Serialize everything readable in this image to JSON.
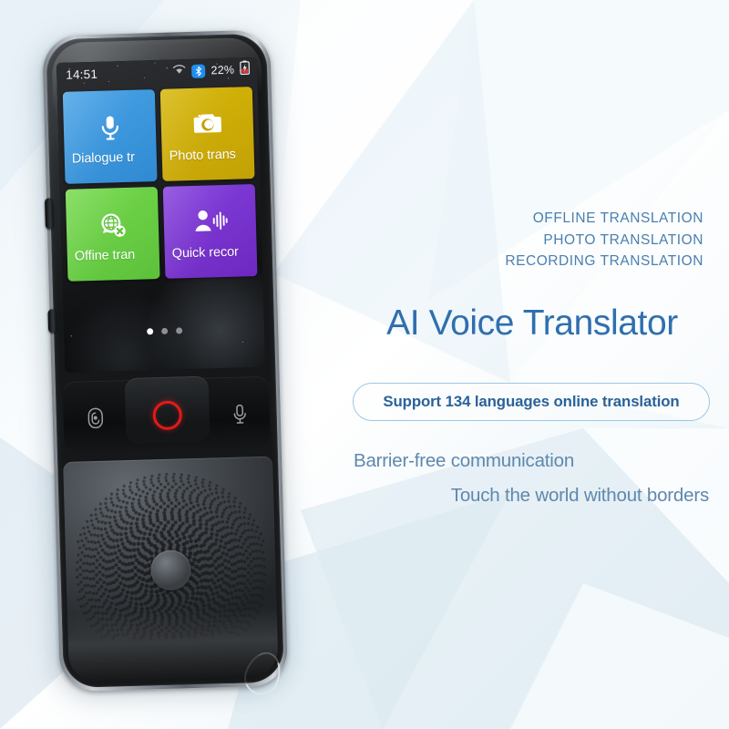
{
  "device": {
    "status_bar": {
      "time": "14:51",
      "wifi_icon": "wifi-icon",
      "bluetooth_icon": "bluetooth-icon",
      "battery_percent": "22%",
      "battery_icon": "battery-charging-icon"
    },
    "tiles": [
      {
        "label": "Dialogue tr",
        "icon": "microphone-icon",
        "color": "#3d9ae0"
      },
      {
        "label": "Photo trans",
        "icon": "camera-icon",
        "color": "#ccab08"
      },
      {
        "label": "Offine tran",
        "icon": "globe-offline-icon",
        "color": "#68cf44"
      },
      {
        "label": "Quick recor",
        "icon": "person-voice-icon",
        "color": "#7632cb"
      }
    ],
    "page_dots": {
      "count": 3,
      "active_index": 0
    },
    "controls": [
      {
        "name": "fingerprint-button",
        "icon": "fingerprint-icon"
      },
      {
        "name": "record-button",
        "icon": "record-circle-icon",
        "color": "#e01b1b"
      },
      {
        "name": "microphone-button",
        "icon": "microphone-outline-icon"
      }
    ],
    "speaker": {
      "name": "speaker-grille",
      "hub": "speaker-center-hub"
    },
    "lanyard": "lanyard-loop"
  },
  "marketing": {
    "kicker_lines": [
      "OFFLINE TRANSLATION",
      "PHOTO TRANSLATION",
      "RECORDING TRANSLATION"
    ],
    "headline": "AI Voice Translator",
    "pill": "Support 134 languages online translation",
    "sub_line_1": "Barrier-free communication",
    "sub_line_2": "Touch the world without borders"
  },
  "colors": {
    "accent_blue": "#2f6fae",
    "kicker_blue": "#4a7fae",
    "sub_blue": "#5f88ad",
    "pill_border": "#9ec6e2",
    "bluetooth_blue": "#1e8ff0",
    "record_red": "#e01b1b"
  }
}
